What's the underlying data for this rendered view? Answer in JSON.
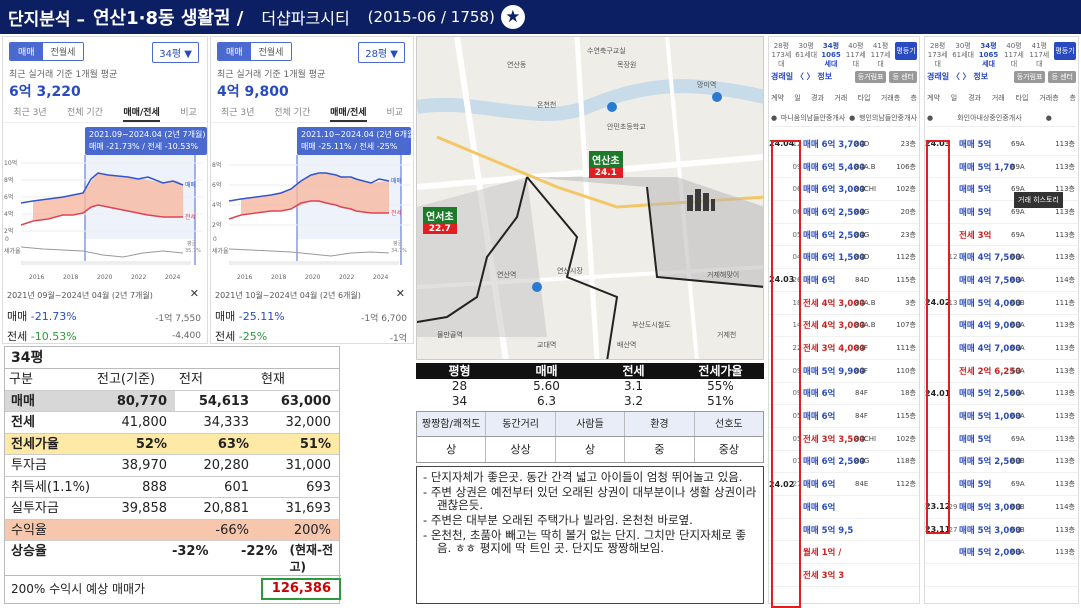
{
  "header": {
    "title": "단지분석 –",
    "area": "연산1·8동 생활권 /",
    "complex": "더샵파크시티",
    "meta": "(2015-06 / 1758)"
  },
  "panels": [
    {
      "seg": [
        "매매",
        "전월세"
      ],
      "size": "34평 ▼",
      "avg_label": "최근 실거래 기준 1개월 평균",
      "avg_price": "6억 3,220",
      "tabs": [
        "최근 3년",
        "전체 기간",
        "매매/전세",
        "비교"
      ],
      "tip1": "2021.09~2024.04 (2년 7개월)",
      "tip2": "매매 -21.73% / 전세 -10.53%",
      "yt": [
        "10억",
        "8억",
        "6억",
        "4억",
        "2억",
        "0",
        "세가율"
      ],
      "xt": [
        "2016",
        "2018",
        "2020",
        "2022",
        "2024"
      ],
      "leg_sale": "매매",
      "leg_jeon": "전세",
      "leg_avg": "평균",
      "leg_pct": "35.1%",
      "foot": "2021년 09월~2024년 04월 (2년 7개월)",
      "close": "✕",
      "sale_l": "매매",
      "sale_pct": "-21.73%",
      "sale_r": "-1억 7,550",
      "jeon_l": "전세",
      "jeon_pct": "-10.53%",
      "jeon_r": "-4,400"
    },
    {
      "seg": [
        "매매",
        "전월세"
      ],
      "size": "28평 ▼",
      "avg_label": "최근 실거래 기준 1개월 평균",
      "avg_price": "4억 9,800",
      "tabs": [
        "최근 3년",
        "전체 기간",
        "매매/전세",
        "비교"
      ],
      "tip1": "2021.10~2024.04 (2년 6개월)",
      "tip2": "매매 -25.11% / 전세 -25%",
      "yt": [
        "8억",
        "6억",
        "4억",
        "2억",
        "0",
        "세가율"
      ],
      "xt": [
        "2016",
        "2018",
        "2020",
        "2022",
        "2024"
      ],
      "leg_sale": "매매",
      "leg_jeon": "전세",
      "leg_avg": "평균",
      "leg_pct": "34.7%",
      "foot": "2021년 10월~2024년 04월 (2년 6개월)",
      "close": "✕",
      "sale_l": "매매",
      "sale_pct": "-25.11%",
      "sale_r": "-1억 6,700",
      "jeon_l": "전세",
      "jeon_pct": "-25%",
      "jeon_r": "-1억"
    }
  ],
  "price_table": {
    "title": "34평",
    "rows": [
      [
        "구분",
        "전고(기준)",
        "전저",
        "현재"
      ],
      [
        "매매",
        "80,770",
        "54,613",
        "63,000"
      ],
      [
        "전세",
        "41,800",
        "34,333",
        "32,000"
      ],
      [
        "전세가율",
        "52%",
        "63%",
        "51%"
      ],
      [
        "투자금",
        "38,970",
        "20,280",
        "31,000"
      ],
      [
        "취득세(1.1%)",
        "888",
        "601",
        "693"
      ],
      [
        "실투자금",
        "39,858",
        "20,881",
        "31,693"
      ],
      [
        "수익율",
        "",
        "-66%",
        "200%"
      ],
      [
        "상승율",
        "",
        "-32%",
        "-22%"
      ]
    ],
    "note": "(현재-전고)",
    "footer_label": "200% 수익시 예상 매매가",
    "footer_value": "126,386"
  },
  "map": {
    "pin1": {
      "name": "연산초",
      "val": "24.1"
    },
    "pin2": {
      "name": "연서초",
      "val": "22.7"
    },
    "labels": [
      "수연축구교실",
      "목장원",
      "연산동",
      "온천천",
      "망미역",
      "안민초등학교",
      "연산역",
      "물만골역",
      "연산시장",
      "배산역",
      "부산도시철도",
      "거제천",
      "교대역",
      "거제해맞이"
    ]
  },
  "summary": {
    "head": [
      "평형",
      "매매",
      "전세",
      "전세가율"
    ],
    "rows": [
      [
        "28",
        "5.60",
        "3.1",
        "55%"
      ],
      [
        "34",
        "6.3",
        "3.2",
        "51%"
      ]
    ]
  },
  "evaluation": {
    "head": [
      "짱짱함/쾌적도",
      "동간거리",
      "사람들",
      "환경",
      "선호도"
    ],
    "vals": [
      "상",
      "상상",
      "상",
      "중",
      "중상"
    ]
  },
  "comments": [
    "단지자체가 좋은곳. 동간 간격 넓고 아이들이 엄청 뛰어놀고 있음.",
    "주변 상권은 예전부터 있던 오래된 상권이 대부분이나 생활 상권이라 괜찮은듯.",
    "주변은 대부분 오래된 주택가나 빌라임. 온천천 바로옆.",
    "온천천, 초품아 빼고는 딱히 볼거 없는 단지. 그치만 단지자체로 좋음. ㅎㅎ 평지에 딱 트인 곳. 단지도 짱짱해보임."
  ],
  "tx1": {
    "areas": [
      [
        "28평",
        "173세대"
      ],
      [
        "30평",
        "61세대"
      ],
      [
        "34평",
        "1065세대"
      ],
      [
        "40평",
        "117세대"
      ],
      [
        "41평",
        "117세대"
      ]
    ],
    "reg": "평등기",
    "sub": "경래일 〈 〉 정보",
    "btns": [
      "등거림표",
      "등 센터"
    ],
    "cols": [
      "계약",
      "일",
      "경과",
      "거래",
      "타입",
      "거래층",
      "층"
    ],
    "agent1": "마니움의남들안중개사",
    "agent2": "행인의남들안중개사",
    "rows": [
      [
        "24.04",
        "12",
        "매매 6억 3,700",
        "84D",
        "23층"
      ],
      [
        "",
        "09",
        "매매 6억 5,400",
        "84A.B",
        "106층"
      ],
      [
        "",
        "06",
        "매매 6억 3,000",
        "84CHI",
        "102층"
      ],
      [
        "",
        "06",
        "매매 6억 2,500",
        "84G",
        "20층"
      ],
      [
        "",
        "05",
        "매매 6억 2,500",
        "84G",
        "23층"
      ],
      [
        "",
        "04",
        "매매 6억 1,500",
        "84D",
        "112층"
      ],
      [
        "24.03",
        "26",
        "매매 6억",
        "84D",
        "115층"
      ],
      [
        "",
        "18",
        "전세 4억 3,000",
        "84A.B",
        "3층"
      ],
      [
        "",
        "14",
        "전세 4억 3,000",
        "84A.B",
        "107층"
      ],
      [
        "",
        "22",
        "전세 3억 4,000",
        "84F",
        "111층"
      ],
      [
        "",
        "09",
        "매매 5억 9,900",
        "84F",
        "110층"
      ],
      [
        "",
        "09",
        "매매 6억",
        "84F",
        "18층"
      ],
      [
        "",
        "05",
        "매매 6억",
        "84F",
        "115층"
      ],
      [
        "",
        "05",
        "전세 3억 3,500",
        "84CHI",
        "102층"
      ],
      [
        "",
        "01",
        "매매 6억 2,500",
        "84G",
        "118층"
      ],
      [
        "24.02",
        "21",
        "매매 6억",
        "84E",
        "112층"
      ],
      [
        "",
        "",
        "매매 6억",
        "",
        ""
      ],
      [
        "",
        "",
        "매매 5억 9,5",
        "",
        ""
      ],
      [
        "",
        "",
        "월세 1억 /",
        "",
        ""
      ],
      [
        "",
        "",
        "전세 3억 3",
        "",
        ""
      ]
    ]
  },
  "tx2": {
    "areas": [
      [
        "28평",
        "173세대"
      ],
      [
        "30평",
        "61세대"
      ],
      [
        "34평",
        "1065세대"
      ],
      [
        "40평",
        "117세대"
      ],
      [
        "41평",
        "117세대"
      ]
    ],
    "reg": "평등기",
    "sub": "경래일 〈 〉 정보",
    "btns": [
      "등거림표",
      "등 센터"
    ],
    "cols": [
      "계약",
      "일",
      "경과",
      "거래",
      "타입",
      "거래층",
      "층"
    ],
    "agent1": "화인아내상중인중개사",
    "agent2": "",
    "popup": "거래 히스토리",
    "rows": [
      [
        "24.03",
        "",
        "매매 5억",
        "69A",
        "113층"
      ],
      [
        "",
        "",
        "매매 5억 1,70",
        "69A",
        "113층"
      ],
      [
        "",
        "",
        "매매 5억",
        "69A",
        "113층"
      ],
      [
        "",
        "",
        "매매 5억",
        "69A",
        "113층"
      ],
      [
        "",
        "",
        "전세 3억",
        "69A",
        "113층"
      ],
      [
        "",
        "12",
        "매매 4억 7,500",
        "69A",
        "113층"
      ],
      [
        "",
        "",
        "매매 4억 7,500",
        "69A",
        "114층"
      ],
      [
        "24.02",
        "13",
        "매매 5억 4,000",
        "69B",
        "111층"
      ],
      [
        "",
        "",
        "매매 4억 9,000",
        "69A",
        "113층"
      ],
      [
        "",
        "",
        "매매 4억 7,000",
        "69A",
        "113층"
      ],
      [
        "",
        "",
        "전세 2억 6,250",
        "69A",
        "113층"
      ],
      [
        "24.01",
        "",
        "매매 5억 2,500",
        "69A",
        "113층"
      ],
      [
        "",
        "",
        "매매 5억 1,000",
        "69A",
        "113층"
      ],
      [
        "",
        "",
        "매매 5억",
        "69A",
        "113층"
      ],
      [
        "",
        "",
        "매매 5억 2,500",
        "69B",
        "113층"
      ],
      [
        "",
        "",
        "매매 5억",
        "69A",
        "113층"
      ],
      [
        "23.12",
        "29",
        "매매 5억 3,000",
        "69B",
        "114층"
      ],
      [
        "23.11",
        "27",
        "매매 5억 3,000",
        "69B",
        "113층"
      ],
      [
        "",
        "",
        "매매 5억 2,000",
        "69A",
        "113층"
      ],
      [
        "",
        "",
        "",
        "",
        ""
      ]
    ]
  },
  "colors": {
    "navy": "#0d1f63",
    "blue": "#2a4bc0",
    "red": "#e02020",
    "green": "#2a9a3a"
  }
}
